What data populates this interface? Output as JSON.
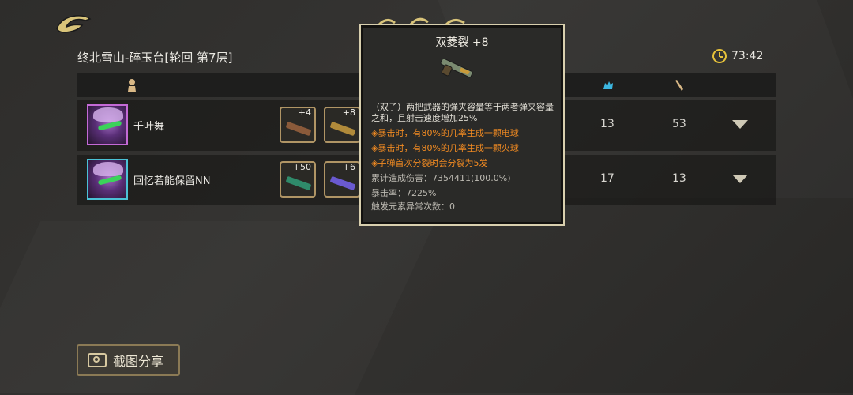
{
  "header": {
    "title": "终北雪山-碎玉台[轮回 第7层]",
    "timer": "73:42"
  },
  "columns": {
    "player_icon": "player-icon",
    "kills_icon": "blue-beast-icon",
    "damage_icon": "bone-icon"
  },
  "players": [
    {
      "name": "千叶舞",
      "weapons": [
        {
          "level": "+4"
        },
        {
          "level": "+8"
        }
      ],
      "stat_a": "13",
      "stat_b": "53"
    },
    {
      "name": "回忆若能保留NN",
      "weapons": [
        {
          "level": "+50"
        },
        {
          "level": "+6"
        }
      ],
      "stat_a": "17",
      "stat_b": "13"
    }
  ],
  "tooltip": {
    "title": "双菱裂 +8",
    "desc": "（双子）两把武器的弹夹容量等于两者弹夹容量之和，且射击速度增加25%",
    "effects": [
      "◈暴击时，有80%的几率生成一颗电球",
      "◈暴击时，有80%的几率生成一颗火球",
      "◈子弹首次分裂时会分裂为5发"
    ],
    "stats": [
      "累计造成伤害：7354411(100.0%)",
      "暴击率：7225%",
      "触发元素异常次数：0"
    ]
  },
  "share_button": {
    "label": "截图分享"
  },
  "colors": {
    "accent_gold": "#b09565",
    "orange": "#f08a22",
    "timer_yellow": "#e6c23a"
  }
}
